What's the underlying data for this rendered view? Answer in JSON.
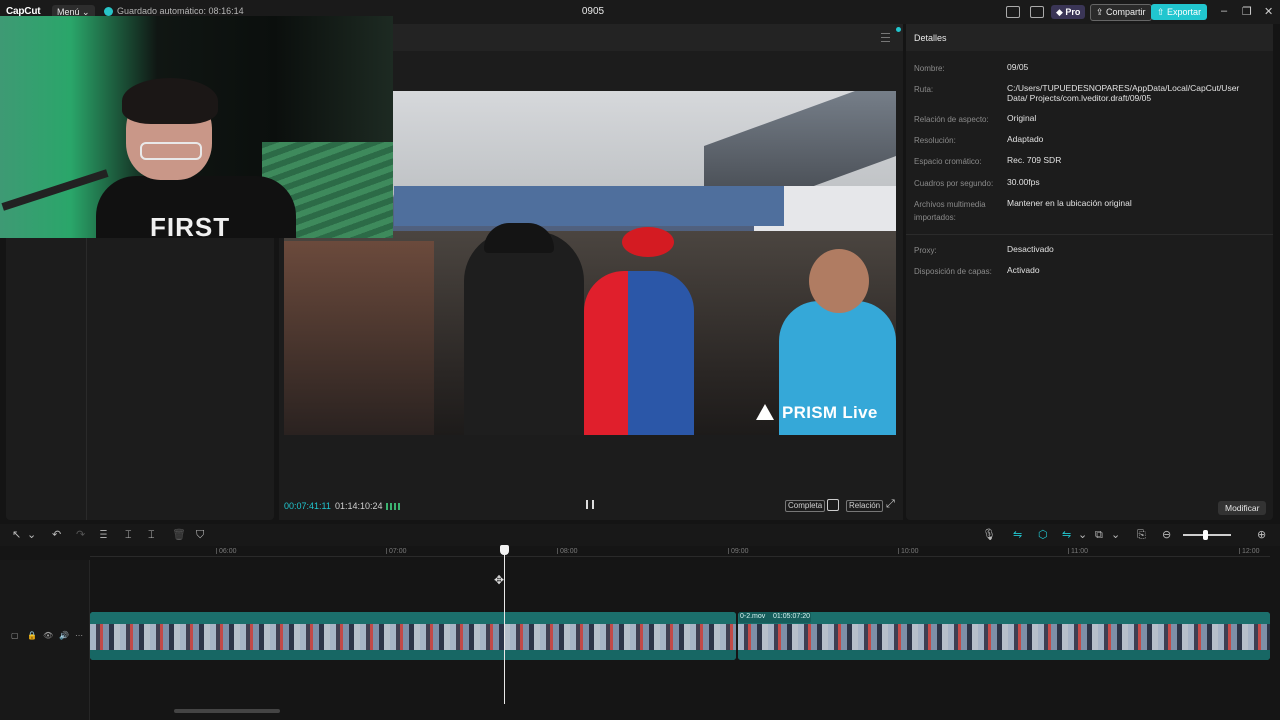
{
  "app": {
    "logo": "CapCut",
    "menu_label": "Menú",
    "autosave": "Guardado automático: 08:16:14",
    "project_title": "0905",
    "pro_label": "Pro",
    "share_label": "Compartir",
    "export_label": "Exportar",
    "accent_color": "#21c6cf"
  },
  "window_controls": {
    "minimize": "–",
    "maximize": "❐",
    "close": "✕"
  },
  "webcam": {
    "shirt_text": "FIRST"
  },
  "video": {
    "watermark": "PRISM Live"
  },
  "player": {
    "current_time": "00:07:41:11",
    "total_time": "01:14:10:24",
    "full_label": "Completa",
    "ratio_label": "Relación"
  },
  "details": {
    "title": "Detalles",
    "rows": [
      {
        "label": "Nombre:",
        "value": "09/05"
      },
      {
        "label": "Ruta:",
        "value": "C:/Users/TUPUEDESNOPARES/AppData/Local/CapCut/User Data/ Projects/com.lveditor.draft/09/05"
      },
      {
        "label": "Relación de aspecto:",
        "value": "Original"
      },
      {
        "label": "Resolución:",
        "value": "Adaptado"
      },
      {
        "label": "Espacio cromático:",
        "value": "Rec. 709 SDR"
      },
      {
        "label": "Cuadros por segundo:",
        "value": "30.00fps"
      },
      {
        "label": "Archivos multimedia importados:",
        "value": "Mantener en la ubicación original"
      },
      {
        "label": "Proxy:",
        "value": "Desactivado"
      },
      {
        "label": "Disposición de capas:",
        "value": "Activado"
      }
    ],
    "modify_label": "Modificar"
  },
  "timeline": {
    "ruler": [
      "06:00",
      "07:00",
      "08:00",
      "09:00",
      "10:00",
      "11:00",
      "12:00"
    ],
    "clip_name": "0-2.mov",
    "clip_duration": "01:05:07:20"
  },
  "toolbar_icons": {
    "select": "↖",
    "select_menu": "⌄",
    "undo": "↶",
    "redo": "↷",
    "split": "Ⲷ",
    "trim_left": "⌶",
    "trim_right": "⌶",
    "delete": "🗑",
    "shield": "⛉",
    "mic": "🎙",
    "link1": "⇋",
    "link2": "⬡",
    "link3": "⇋",
    "link3_menu": "⌄",
    "preview_axis": "⧉",
    "preview_axis_menu": "⌄",
    "caption": "⎘",
    "zoom_out": "⊖",
    "zoom_in": "⊕"
  },
  "track_controls": [
    "▢",
    "🔒",
    "👁",
    "🔊",
    "⋯"
  ]
}
